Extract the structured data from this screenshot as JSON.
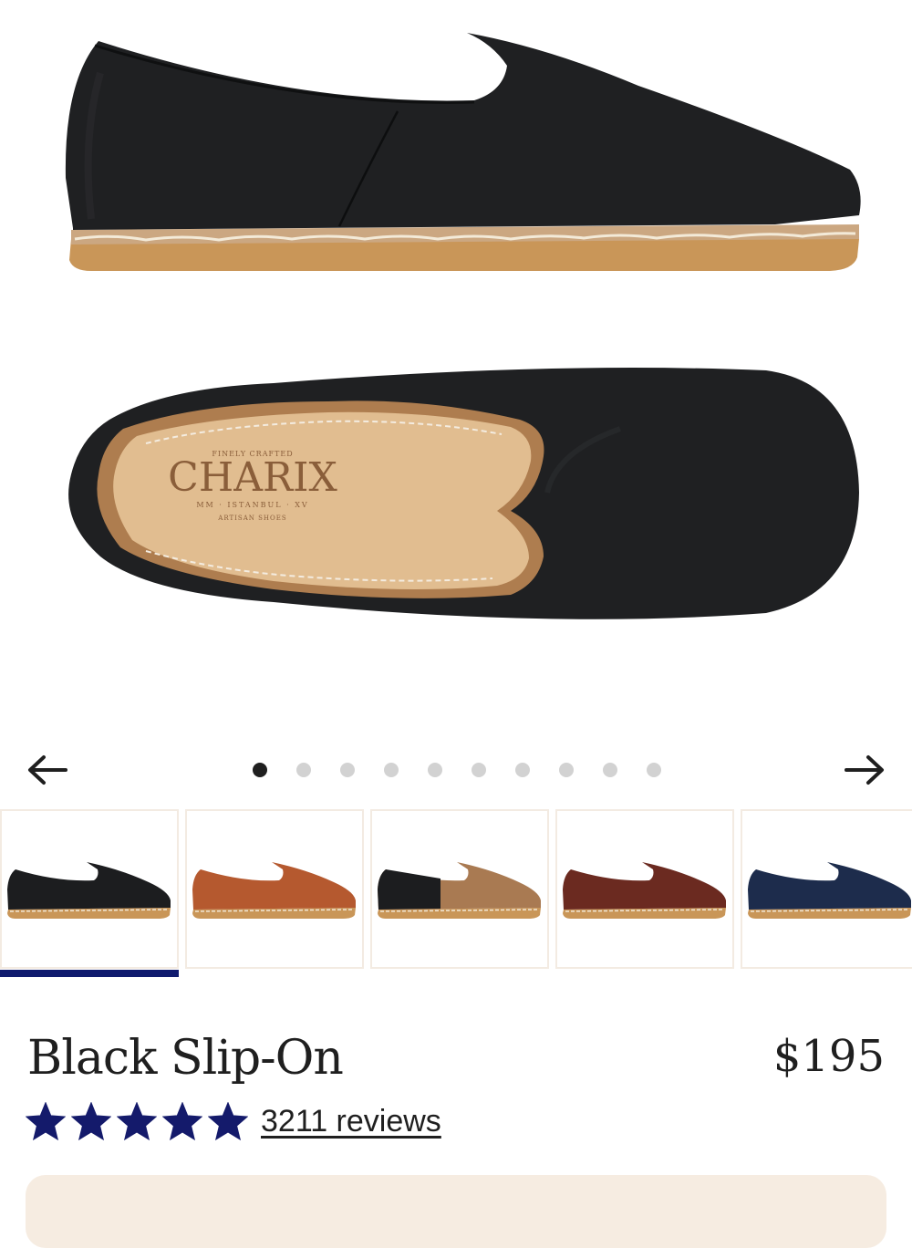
{
  "gallery": {
    "main_image_brand": "CHARIX",
    "dot_count": 10,
    "active_dot": 1,
    "prev_icon": "arrow-left-icon",
    "next_icon": "arrow-right-icon"
  },
  "variants": [
    {
      "color_name": "black",
      "leather": "#1c1d1f",
      "selected": true
    },
    {
      "color_name": "cognac",
      "leather": "#b5592f",
      "selected": false
    },
    {
      "color_name": "black-tan",
      "leather": "#a97a52",
      "selected": false
    },
    {
      "color_name": "burgundy-brown",
      "leather": "#6b2a20",
      "selected": false
    },
    {
      "color_name": "navy",
      "leather": "#1d2c4c",
      "selected": false
    }
  ],
  "product": {
    "name": "Black Slip-On",
    "price": "$195",
    "rating": 5,
    "reviews_label": "3211 reviews"
  },
  "colors": {
    "accent": "#0f1a6e",
    "star": "#141a6b",
    "promo_bg": "#f6ece1"
  }
}
